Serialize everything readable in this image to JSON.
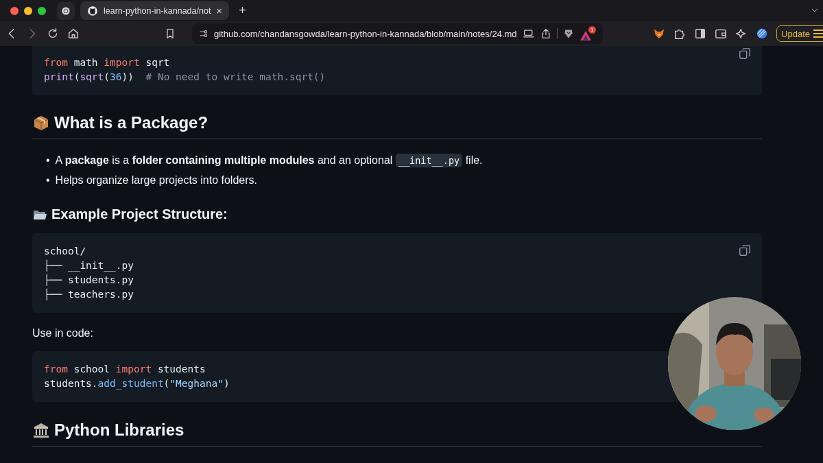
{
  "browser": {
    "tabs": [
      {
        "title": "learn-python-in-kannada/not",
        "close": "×",
        "selected": true
      }
    ],
    "new_tab": "+",
    "url": "github.com/chandansgowda/learn-python-in-kannada/blob/main/notes/24.md",
    "rewards_badge": "1",
    "update_button": "Update"
  },
  "document": {
    "blocks": [
      {
        "kind": "code",
        "copy_button": true,
        "lines": [
          [
            {
              "kind": "keyword",
              "text": "from"
            },
            {
              "kind": "plain",
              "text": " math "
            },
            {
              "kind": "keyword",
              "text": "import"
            },
            {
              "kind": "plain",
              "text": " sqrt"
            }
          ],
          [
            {
              "kind": "func",
              "text": "print"
            },
            {
              "kind": "plain",
              "text": "("
            },
            {
              "kind": "func",
              "text": "sqrt"
            },
            {
              "kind": "plain",
              "text": "("
            },
            {
              "kind": "number",
              "text": "36"
            },
            {
              "kind": "plain",
              "text": "))  "
            },
            {
              "kind": "comment",
              "text": "# No need to write math.sqrt()"
            }
          ]
        ]
      },
      {
        "kind": "h2",
        "text": "What is a Package?"
      },
      {
        "kind": "list",
        "items": [
          {
            "marker": "•",
            "segments": [
              {
                "kind": "text",
                "text": "A **package** is a **folder containing multiple modules** and an optional "
              },
              {
                "kind": "code",
                "text": "__init__.py"
              },
              {
                "kind": "text",
                "text": " file."
              }
            ]
          },
          {
            "marker": "•",
            "segments": [
              {
                "kind": "text",
                "text": "Helps organize large projects into folders."
              }
            ]
          }
        ]
      },
      {
        "kind": "h3",
        "text": "Example Project Structure:"
      },
      {
        "kind": "code",
        "copy_button": true,
        "lines": [
          [
            {
              "kind": "plain",
              "text": "school/"
            }
          ],
          [
            {
              "kind": "plain",
              "text": "├── __init__.py"
            }
          ],
          [
            {
              "kind": "plain",
              "text": "├── students.py"
            }
          ],
          [
            {
              "kind": "plain",
              "text": "├── teachers.py"
            }
          ]
        ]
      },
      {
        "kind": "paragraph",
        "text": "Use in code:"
      },
      {
        "kind": "code",
        "copy_button": false,
        "lines": [
          [
            {
              "kind": "keyword",
              "text": "from"
            },
            {
              "kind": "plain",
              "text": " school "
            },
            {
              "kind": "keyword",
              "text": "import"
            },
            {
              "kind": "plain",
              "text": " students"
            }
          ],
          [
            {
              "kind": "plain",
              "text": "students."
            },
            {
              "kind": "call",
              "text": "add_student"
            },
            {
              "kind": "plain",
              "text": "("
            },
            {
              "kind": "string",
              "text": "\"Meghana\""
            },
            {
              "kind": "plain",
              "text": ")"
            }
          ]
        ]
      },
      {
        "kind": "h2",
        "text": "Python Libraries"
      }
    ]
  }
}
